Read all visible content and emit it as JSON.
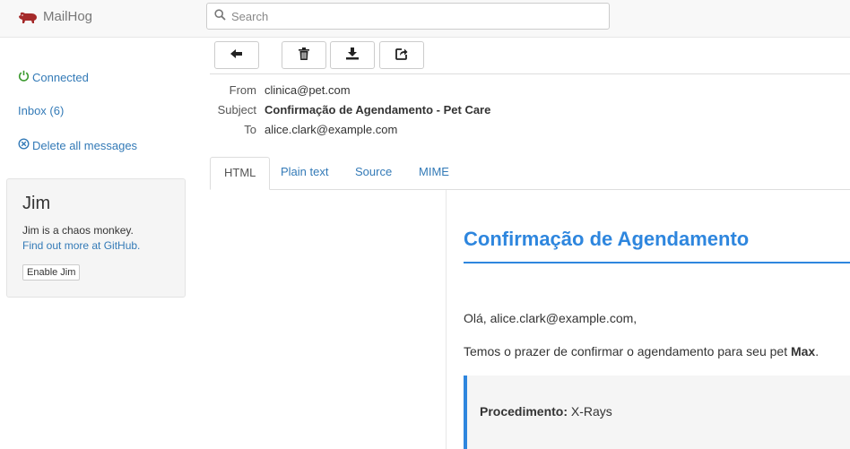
{
  "app": {
    "name": "MailHog"
  },
  "search": {
    "placeholder": "Search"
  },
  "sidebar": {
    "connected": "Connected",
    "inbox": "Inbox (6)",
    "delete_all": "Delete all messages"
  },
  "jim": {
    "title": "Jim",
    "description": "Jim is a chaos monkey.",
    "link": "Find out more at GitHub.",
    "button": "Enable Jim"
  },
  "toolbar": {
    "icons": [
      "back-arrow-icon",
      "trash-icon",
      "download-icon",
      "release-icon"
    ]
  },
  "message": {
    "headers": {
      "from_label": "From",
      "from": "clinica@pet.com",
      "subject_label": "Subject",
      "subject": "Confirmação de Agendamento - Pet Care",
      "to_label": "To",
      "to": "alice.clark@example.com"
    },
    "tabs": [
      "HTML",
      "Plain text",
      "Source",
      "MIME"
    ],
    "active_tab": "HTML",
    "body": {
      "heading": "Confirmação de Agendamento",
      "greeting": "Olá, alice.clark@example.com,",
      "intro": "Temos o prazer de confirmar o agendamento para seu pet ",
      "pet_name": "Max",
      "intro_end": ".",
      "procedure_label": "Procedimento:",
      "procedure": " X-Rays"
    }
  },
  "colors": {
    "accent": "#2e86de",
    "link": "#337ab7",
    "connected": "#3c9a2f",
    "brand_icon": "#a52a2a"
  }
}
